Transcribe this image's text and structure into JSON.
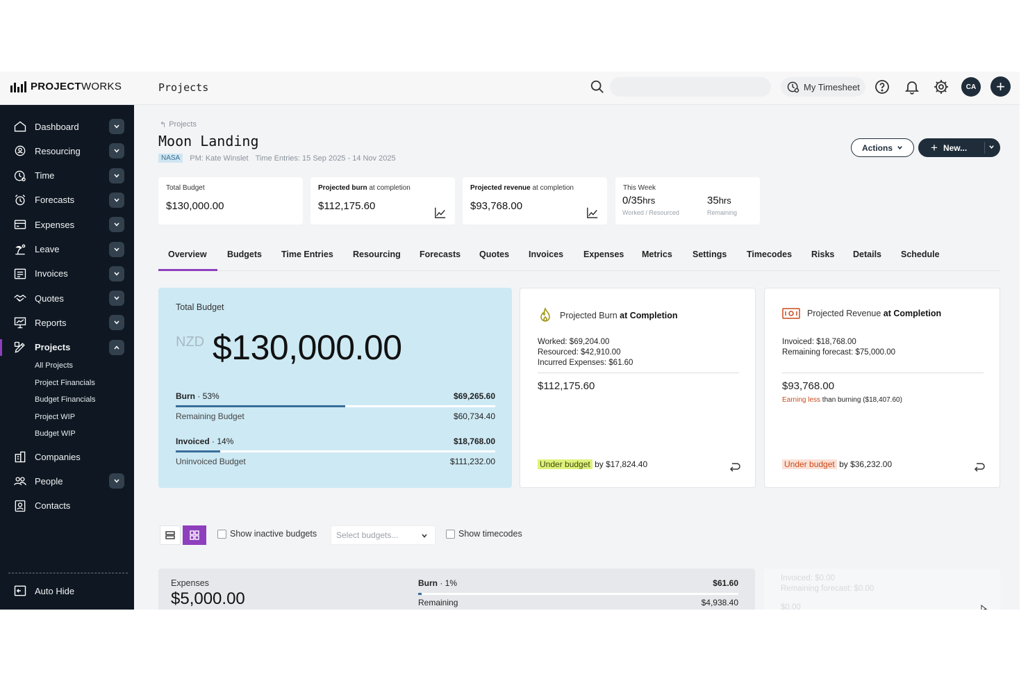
{
  "brand": {
    "name_bold": "PROJECT",
    "name_rest": "WORKS"
  },
  "header": {
    "page_name": "Projects",
    "search_placeholder": "",
    "timesheet_label": "My Timesheet",
    "avatar_initials": "CA"
  },
  "sidebar": {
    "items": [
      {
        "label": "Dashboard",
        "icon": "home-icon",
        "has_chevron": true
      },
      {
        "label": "Resourcing",
        "icon": "resourcing-icon",
        "has_chevron": true
      },
      {
        "label": "Time",
        "icon": "clock-icon",
        "has_chevron": true
      },
      {
        "label": "Forecasts",
        "icon": "forecast-icon",
        "has_chevron": true
      },
      {
        "label": "Expenses",
        "icon": "card-icon",
        "has_chevron": true
      },
      {
        "label": "Leave",
        "icon": "leave-icon",
        "has_chevron": true
      },
      {
        "label": "Invoices",
        "icon": "invoice-icon",
        "has_chevron": true
      },
      {
        "label": "Quotes",
        "icon": "handshake-icon",
        "has_chevron": true
      },
      {
        "label": "Reports",
        "icon": "report-icon",
        "has_chevron": true
      },
      {
        "label": "Projects",
        "icon": "projects-icon",
        "has_chevron": true,
        "active": true
      },
      {
        "label": "Companies",
        "icon": "building-icon",
        "has_chevron": false
      },
      {
        "label": "People",
        "icon": "people-icon",
        "has_chevron": true
      },
      {
        "label": "Contacts",
        "icon": "contacts-icon",
        "has_chevron": false
      }
    ],
    "sub_items": [
      "All Projects",
      "Project Financials",
      "Budget Financials",
      "Project WIP",
      "Budget WIP"
    ],
    "auto_hide_label": "Auto Hide"
  },
  "project": {
    "breadcrumb": "Projects",
    "title": "Moon Landing",
    "client": "NASA",
    "pm": "PM: Kate Winslet",
    "time_entries": "Time Entries: 15 Sep 2025 - 14 Nov 2025",
    "actions_label": "Actions",
    "new_label": "New..."
  },
  "summary": {
    "total_budget": {
      "caption": "Total Budget",
      "value": "$130,000.00"
    },
    "projected_burn": {
      "caption_bold": "Projected burn",
      "caption_rest": " at completion",
      "value": "$112,175.60"
    },
    "projected_revenue": {
      "caption_bold": "Projected revenue",
      "caption_rest": " at completion",
      "value": "$93,768.00"
    },
    "this_week": {
      "caption": "This Week",
      "worked": "0",
      "resourced": "35",
      "unit": "hrs",
      "worked_sub": "Worked / Resourced",
      "remaining": "35",
      "remaining_sub": "Remaining"
    }
  },
  "tabs": [
    "Overview",
    "Budgets",
    "Time Entries",
    "Resourcing",
    "Forecasts",
    "Quotes",
    "Invoices",
    "Expenses",
    "Metrics",
    "Settings",
    "Timecodes",
    "Risks",
    "Details",
    "Schedule"
  ],
  "active_tab": "Overview",
  "budget_card": {
    "label": "Total Budget",
    "currency": "NZD",
    "amount": "$130,000.00",
    "burn_label": "Burn",
    "burn_pct_text": " · 53%",
    "burn_fraction": 0.53,
    "burn_value": "$69,265.60",
    "remaining_label": "Remaining Budget",
    "remaining_value": "$60,734.40",
    "invoiced_label": "Invoiced",
    "invoiced_pct_text": " · 14%",
    "invoiced_fraction": 0.14,
    "invoiced_value": "$18,768.00",
    "uninvoiced_label": "Uninvoiced Budget",
    "uninvoiced_value": "$111,232.00"
  },
  "burn_card": {
    "title_rest": "Projected Burn ",
    "title_bold": "at Completion",
    "worked": "Worked: $69,204.00",
    "resourced": "Resourced: $42,910.00",
    "incurred": "Incurred Expenses: $61.60",
    "total": "$112,175.60",
    "status": "Under budget",
    "status_rest": " by $17,824.40"
  },
  "revenue_card": {
    "title_rest": "Projected Revenue ",
    "title_bold": "at Completion",
    "invoiced": "Invoiced: $18,768.00",
    "remaining": "Remaining forecast: $75,000.00",
    "total": "$93,768.00",
    "note_warn": "Earning less",
    "note_rest": " than burning ($18,407.60)",
    "status": "Under budget",
    "status_rest": " by $36,232.00"
  },
  "filters": {
    "show_inactive": "Show inactive budgets",
    "select_placeholder": "Select budgets...",
    "show_timecodes": "Show timecodes"
  },
  "expenses_card": {
    "label": "Expenses",
    "amount": "$5,000.00",
    "burn_label": "Burn",
    "burn_pct_text": " · 1%",
    "burn_value": "$61.60",
    "remaining_label": "Remaining",
    "remaining_value": "$4,938.40"
  },
  "ghost_card": {
    "invoiced": "Invoiced: $0.00",
    "remaining": "Remaining forecast: $0.00",
    "total": "$0.00"
  },
  "colors": {
    "accent": "#8e3fbd",
    "navy": "#1f2d3a",
    "sidebar": "#0f1822",
    "budget_card": "#cde9f4",
    "progress": "#3a6e9a"
  }
}
